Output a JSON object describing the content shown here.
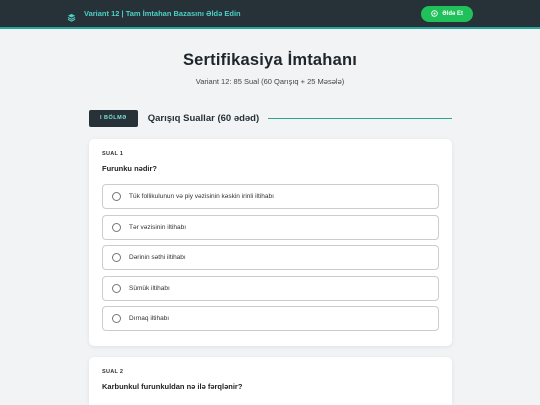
{
  "topbar": {
    "brand_icon": "layers-icon",
    "brand_text": "Variant 12 | Tam İmtahan Bazasını Əldə Edin",
    "cta_icon": "whatsapp-icon",
    "cta_label": "Əldə Et",
    "accent": "#26a69a",
    "cta_color": "#20c05a"
  },
  "hero": {
    "title": "Sertifikasiya İmtahanı",
    "subtitle": "Variant 12: 85 Sual (60 Qarışıq + 25 Məsələ)"
  },
  "section": {
    "tag": "I BÖLMƏ",
    "title": "Qarışıq Suallar (60 ədəd)"
  },
  "questions": [
    {
      "number": "SUAL 1",
      "text": "Furunku nədir?",
      "options": [
        "Tük follikulunun və piy vəzisinin kəskin irinli iltihabı",
        "Tər vəzisinin iltihabı",
        "Dərinin səthi iltihabı",
        "Sümük iltihabı",
        "Dırnaq iltihabı"
      ]
    },
    {
      "number": "SUAL 2",
      "text": "Karbunkul furunkuldan nə ilə fərqlənir?"
    }
  ]
}
